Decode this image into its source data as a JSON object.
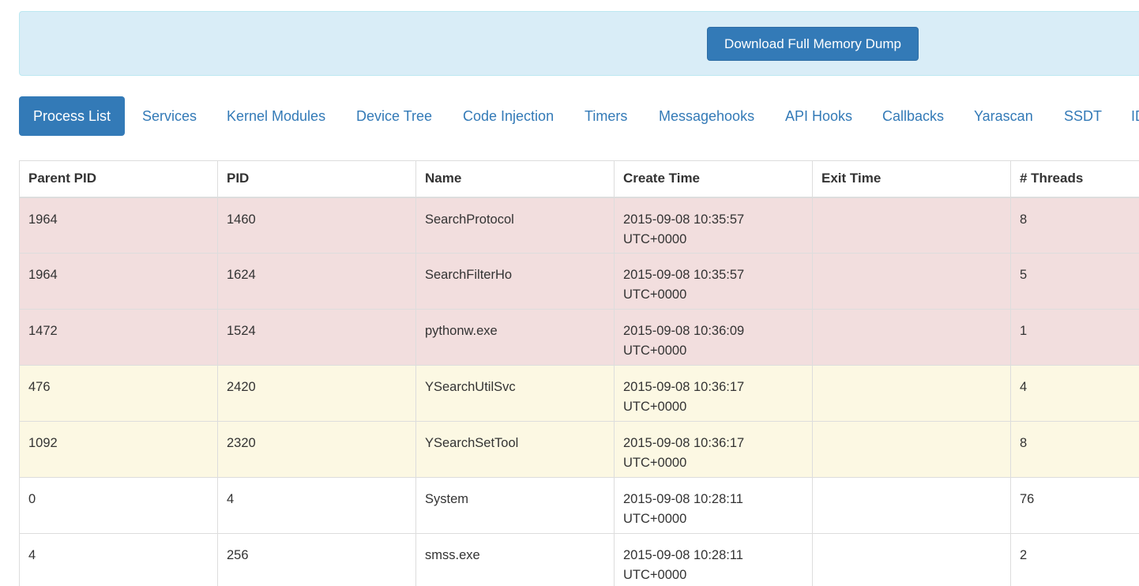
{
  "header": {
    "download_button_label": "Download Full Memory Dump"
  },
  "tabs": [
    {
      "label": "Process List",
      "active": true
    },
    {
      "label": "Services",
      "active": false
    },
    {
      "label": "Kernel Modules",
      "active": false
    },
    {
      "label": "Device Tree",
      "active": false
    },
    {
      "label": "Code Injection",
      "active": false
    },
    {
      "label": "Timers",
      "active": false
    },
    {
      "label": "Messagehooks",
      "active": false
    },
    {
      "label": "API Hooks",
      "active": false
    },
    {
      "label": "Callbacks",
      "active": false
    },
    {
      "label": "Yarascan",
      "active": false
    },
    {
      "label": "SSDT",
      "active": false
    },
    {
      "label": "ID",
      "active": false
    }
  ],
  "table": {
    "columns": [
      "Parent PID",
      "PID",
      "Name",
      "Create Time",
      "Exit Time",
      "# Threads"
    ],
    "rows": [
      {
        "status": "danger",
        "parent_pid": "1964",
        "pid": "1460",
        "name": "SearchProtocol",
        "create_time": "2015-09-08 10:35:57",
        "create_tz": "UTC+0000",
        "exit_time": "",
        "threads": "8"
      },
      {
        "status": "danger",
        "parent_pid": "1964",
        "pid": "1624",
        "name": "SearchFilterHo",
        "create_time": "2015-09-08 10:35:57",
        "create_tz": "UTC+0000",
        "exit_time": "",
        "threads": "5"
      },
      {
        "status": "danger",
        "parent_pid": "1472",
        "pid": "1524",
        "name": "pythonw.exe",
        "create_time": "2015-09-08 10:36:09",
        "create_tz": "UTC+0000",
        "exit_time": "",
        "threads": "1"
      },
      {
        "status": "warning",
        "parent_pid": "476",
        "pid": "2420",
        "name": "YSearchUtilSvc",
        "create_time": "2015-09-08 10:36:17",
        "create_tz": "UTC+0000",
        "exit_time": "",
        "threads": "4"
      },
      {
        "status": "warning",
        "parent_pid": "1092",
        "pid": "2320",
        "name": "YSearchSetTool",
        "create_time": "2015-09-08 10:36:17",
        "create_tz": "UTC+0000",
        "exit_time": "",
        "threads": "8"
      },
      {
        "status": "normal",
        "parent_pid": "0",
        "pid": "4",
        "name": "System",
        "create_time": "2015-09-08 10:28:11",
        "create_tz": "UTC+0000",
        "exit_time": "",
        "threads": "76"
      },
      {
        "status": "normal",
        "parent_pid": "4",
        "pid": "256",
        "name": "smss.exe",
        "create_time": "2015-09-08 10:28:11",
        "create_tz": "UTC+0000",
        "exit_time": "",
        "threads": "2"
      }
    ]
  },
  "colors": {
    "primary": "#337ab7",
    "info_bg": "#d9edf7",
    "danger_row": "#f2dede",
    "warning_row": "#fcf8e3"
  }
}
